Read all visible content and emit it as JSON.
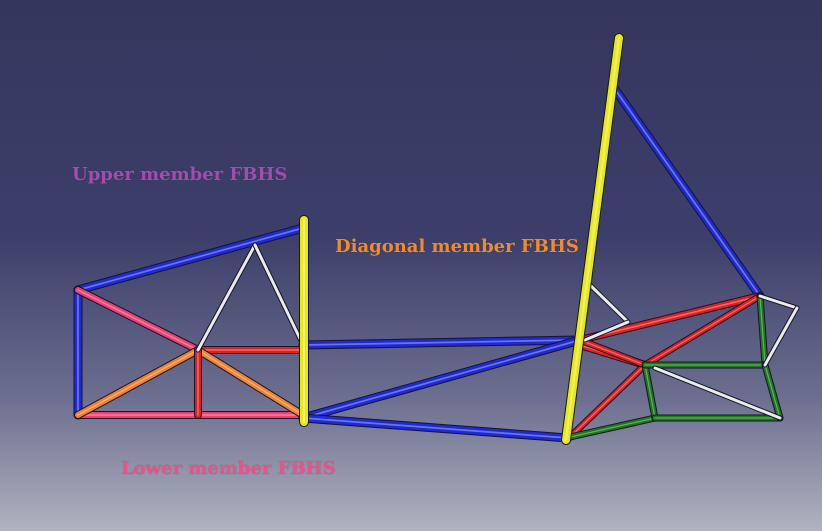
{
  "labels": {
    "upper": "Upper member FBHS",
    "diagonal": "Diagonal member FBHS",
    "lower": "Lower member FBHS"
  },
  "colors": {
    "upper_label": "#a14dab",
    "diagonal_label": "#f08a2c",
    "lower_label": "#f0508a",
    "blue_tube": "#1e2ad6",
    "red_tube": "#e02020",
    "pink_tube": "#ee4070",
    "orange_tube": "#f0822e",
    "yellow_tube": "#e8e81c",
    "green_tube": "#1a7a1a",
    "white_tube": "#e6e6e6"
  }
}
